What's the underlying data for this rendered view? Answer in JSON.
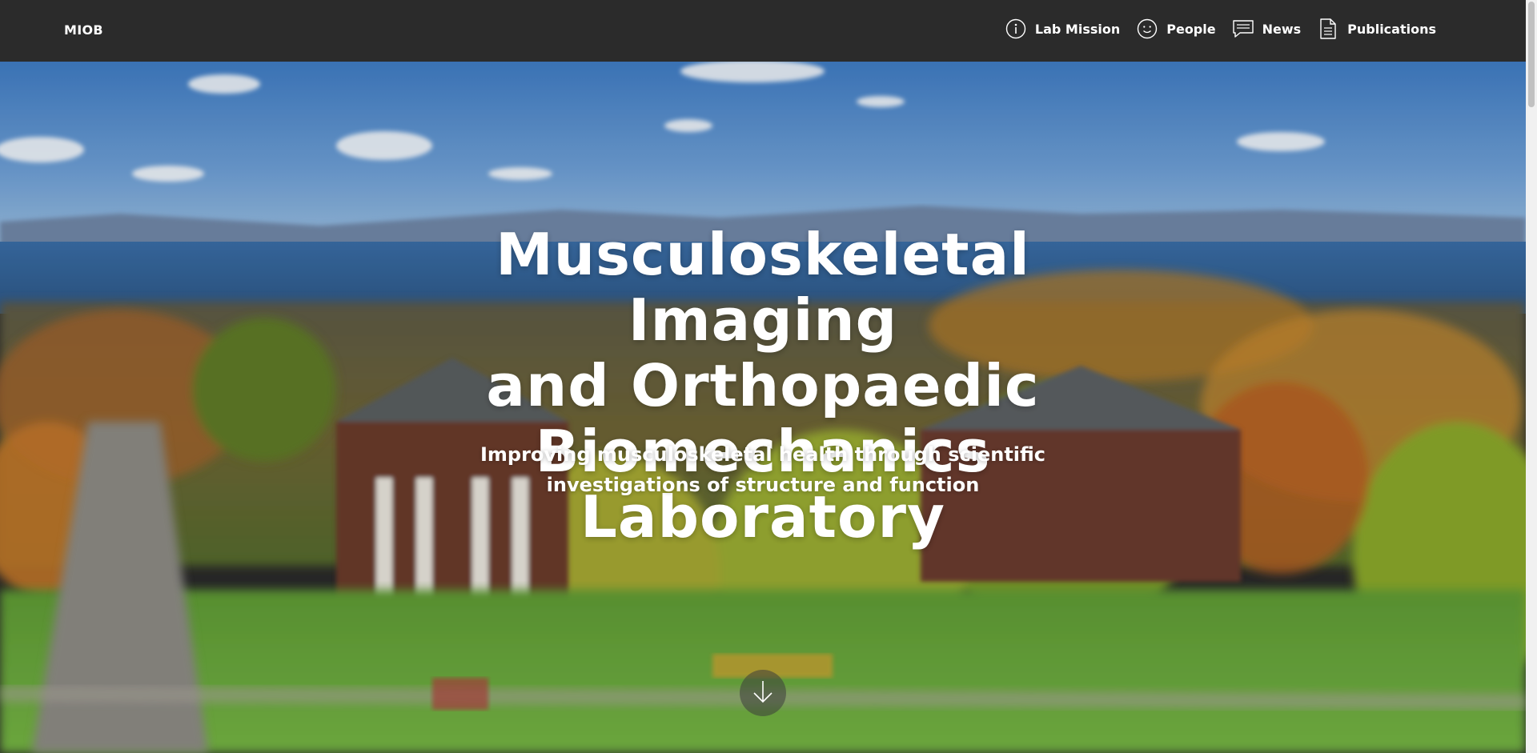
{
  "nav": {
    "brand": "MIOB",
    "links": [
      {
        "label": "Lab Mission",
        "icon": "info-icon"
      },
      {
        "label": "People",
        "icon": "smiley-icon"
      },
      {
        "label": "News",
        "icon": "speech-bubble-icon"
      },
      {
        "label": "Publications",
        "icon": "document-icon"
      }
    ]
  },
  "hero": {
    "title_lines": [
      "Musculoskeletal Imaging",
      "and Orthopaedic",
      "Biomechanics Laboratory"
    ],
    "subtitle": "Improving musculoskeletal health through scientific investigations of structure and function",
    "scroll_icon": "arrow-down-icon"
  },
  "colors": {
    "navbar": "#2b2b2b",
    "text": "#ffffff",
    "sky": "#4a86c8",
    "lake": "#2f5f93",
    "foliage": "#6f8a2e",
    "autumn": "#c7782a",
    "grass": "#6aa53a"
  }
}
